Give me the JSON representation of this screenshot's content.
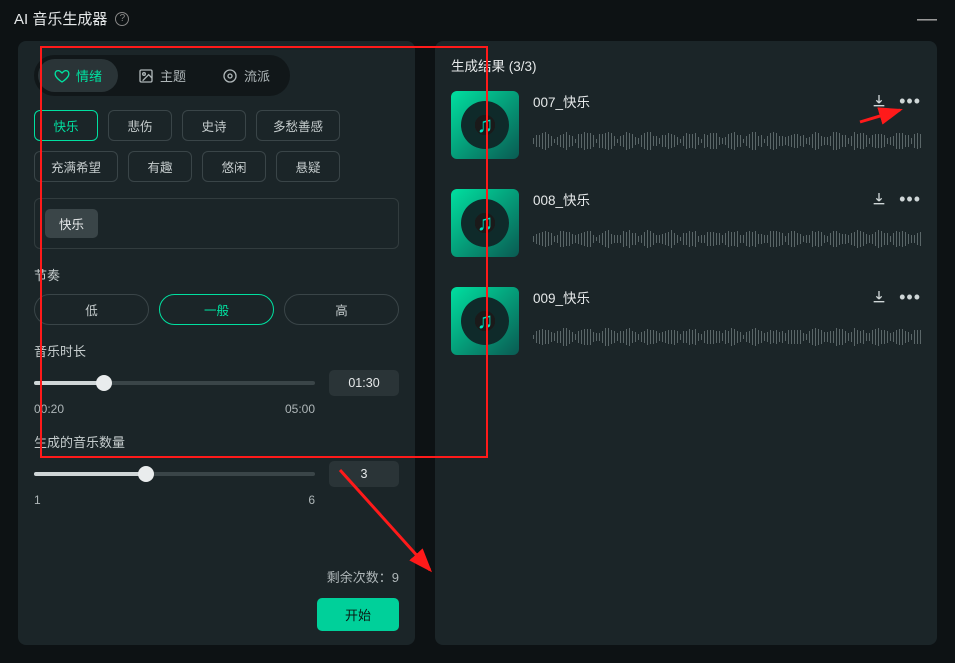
{
  "header": {
    "title": "AI 音乐生成器"
  },
  "tabs": [
    {
      "label": "情绪",
      "active": true
    },
    {
      "label": "主题",
      "active": false
    },
    {
      "label": "流派",
      "active": false
    }
  ],
  "mood_chips": [
    "快乐",
    "悲伤",
    "史诗",
    "多愁善感",
    "充满希望",
    "有趣",
    "悠闲",
    "悬疑"
  ],
  "mood_active_index": 0,
  "selected_tag": "快乐",
  "tempo": {
    "label": "节奏",
    "options": [
      "低",
      "一般",
      "高"
    ],
    "active_index": 1
  },
  "duration": {
    "label": "音乐时长",
    "min_label": "00:20",
    "max_label": "05:00",
    "value_label": "01:30",
    "percent": 25
  },
  "count": {
    "label": "生成的音乐数量",
    "min_label": "1",
    "max_label": "6",
    "value": "3",
    "percent": 40
  },
  "remaining": {
    "label": "剩余次数：",
    "value": "9"
  },
  "start_label": "开始",
  "results": {
    "header_prefix": "生成结果",
    "header_count": "(3/3)",
    "items": [
      {
        "title": "007_快乐"
      },
      {
        "title": "008_快乐"
      },
      {
        "title": "009_快乐"
      }
    ]
  }
}
